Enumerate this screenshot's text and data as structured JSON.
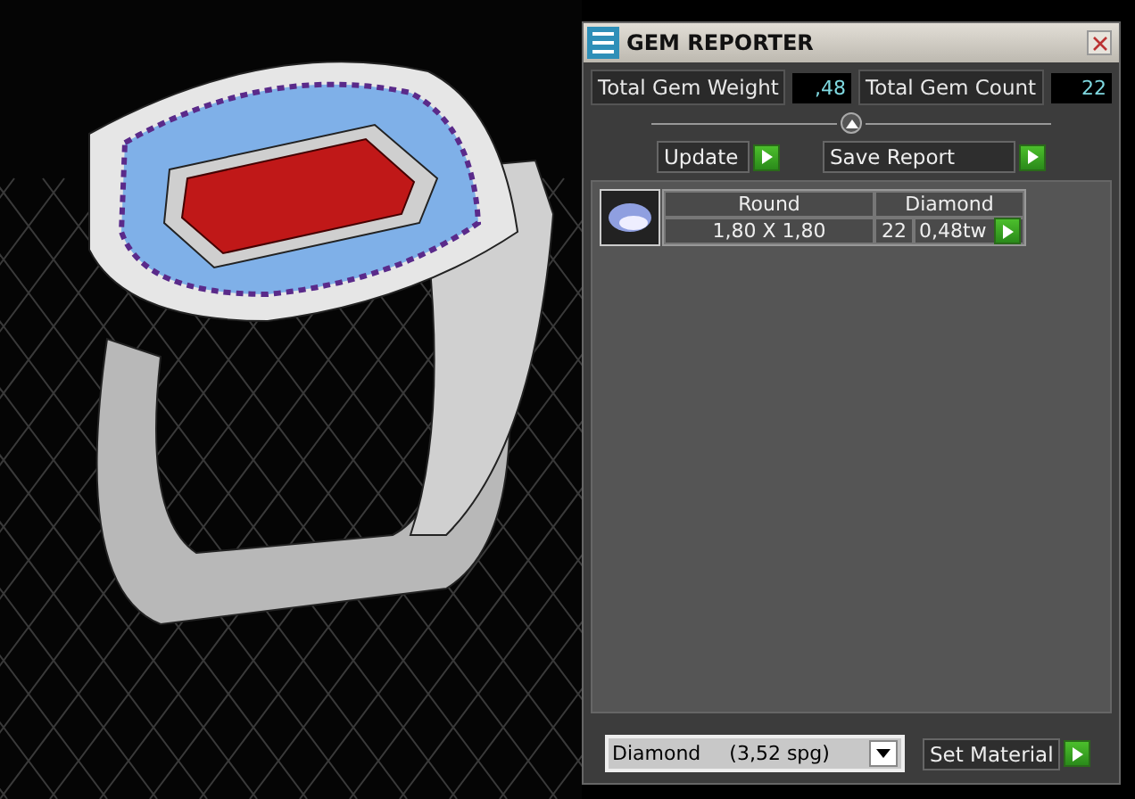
{
  "panel": {
    "title": "GEM REPORTER",
    "total_weight": {
      "label": "Total Gem Weight",
      "value": ",48"
    },
    "total_count": {
      "label": "Total Gem Count",
      "value": "22"
    },
    "buttons": [
      "Update",
      "Save Report"
    ],
    "gems": [
      {
        "shape": "Round",
        "size": "1,80 X 1,80",
        "material": "Diamond",
        "count": "22",
        "weight": "0,48tw"
      }
    ],
    "material_select": {
      "value": "Diamond",
      "density": "(3,52 spg)"
    },
    "set_button": "Set Material"
  }
}
